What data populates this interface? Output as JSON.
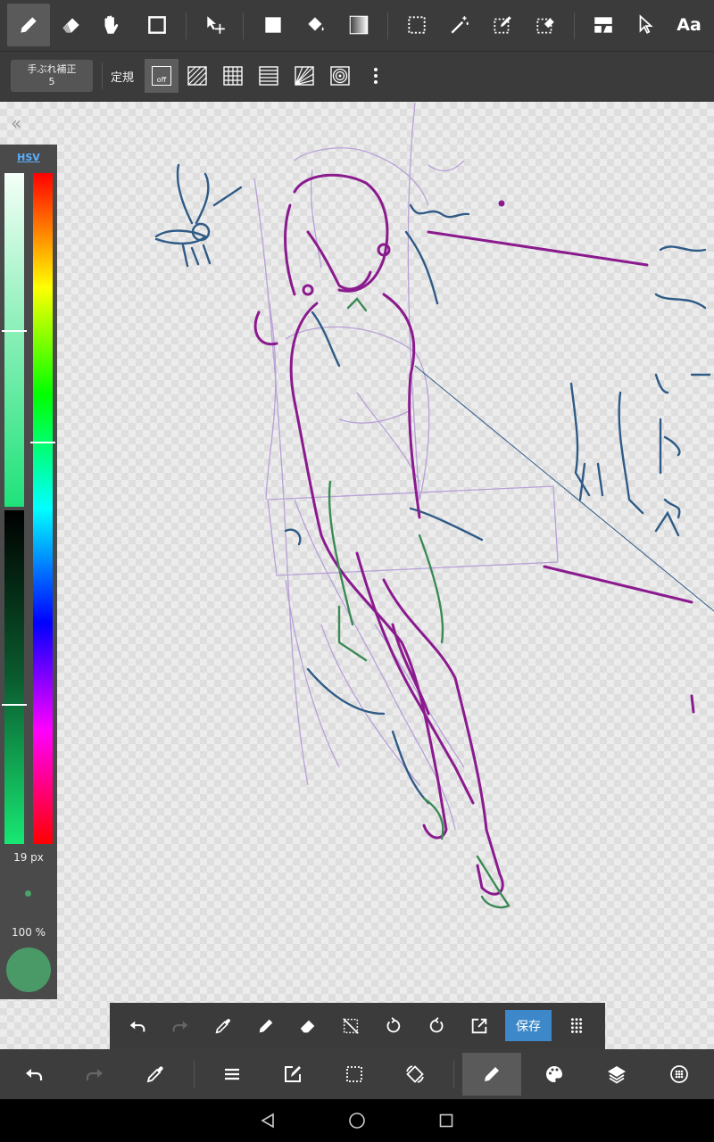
{
  "top_toolbar": {
    "tools": [
      {
        "name": "pen-tool",
        "icon": "pencil-icon",
        "active": true
      },
      {
        "name": "eraser-tool",
        "icon": "eraser-icon"
      },
      {
        "name": "hand-tool",
        "icon": "hand-icon"
      },
      {
        "name": "shape-tool",
        "icon": "square-outline-icon"
      },
      {
        "name": "move-tool",
        "icon": "move-arrow-icon"
      },
      {
        "name": "fill-rect-tool",
        "icon": "filled-square-icon"
      },
      {
        "name": "bucket-tool",
        "icon": "paint-bucket-icon"
      },
      {
        "name": "gradient-tool",
        "icon": "gradient-icon"
      },
      {
        "name": "select-tool",
        "icon": "dotted-rect-icon"
      },
      {
        "name": "magic-wand-tool",
        "icon": "magic-wand-icon"
      },
      {
        "name": "select-pen-tool",
        "icon": "select-pen-icon"
      },
      {
        "name": "select-eraser-tool",
        "icon": "select-eraser-icon"
      },
      {
        "name": "frame-tool",
        "icon": "frame-divider-icon"
      },
      {
        "name": "operation-tool",
        "icon": "cursor-icon"
      },
      {
        "name": "text-tool",
        "icon": "text-icon",
        "label": "Aa"
      }
    ]
  },
  "sub_toolbar": {
    "stabilizer_label": "手ぶれ補正",
    "stabilizer_value": "5",
    "ruler_label": "定規",
    "ruler_off_label": "off",
    "ruler_icons": [
      "ruler-off-icon",
      "parallel-ruler-icon",
      "grid-ruler-icon",
      "perspective-ruler-icon",
      "radial-ruler-icon",
      "concentric-ruler-icon",
      "more-vert-icon"
    ]
  },
  "color_panel": {
    "mode_label": "HSV",
    "brush_size": "19 px",
    "opacity": "100 %",
    "saturation_level": 0.47,
    "value_level": 0.58,
    "hue_level": 0.4,
    "current_color": "#4a9a68"
  },
  "float_toolbar": {
    "icons": [
      "undo-icon",
      "redo-icon",
      "eyedropper-icon",
      "pen-icon",
      "eraser-icon",
      "clear-selection-icon",
      "rotate-left-icon",
      "rotate-right-icon",
      "export-icon"
    ],
    "save_label": "保存",
    "grid_icon": "grid-dots-icon"
  },
  "bottom_toolbar": {
    "icons": [
      "undo-icon",
      "redo-icon",
      "eyedropper-icon",
      "menu-icon",
      "edit-icon",
      "selection-icon",
      "rotate-canvas-icon",
      "brush-icon",
      "palette-icon",
      "layers-icon",
      "materials-icon"
    ]
  },
  "colors": {
    "toolbar_bg": "#3b3b3b",
    "accent_blue": "#3d88c8",
    "sketch_purple": "#8a1a8e",
    "sketch_lavender": "#b49ad6",
    "sketch_blue": "#2f5b86",
    "sketch_green": "#3b8a55"
  },
  "nav_bar": {
    "icons": [
      "back-icon",
      "home-icon",
      "recents-icon"
    ]
  }
}
